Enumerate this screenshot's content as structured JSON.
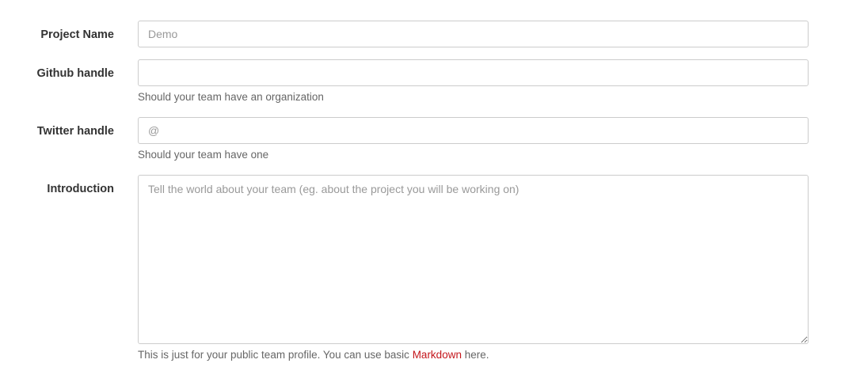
{
  "project_name": {
    "label": "Project Name",
    "value": "",
    "placeholder": "Demo"
  },
  "github": {
    "label": "Github handle",
    "value": "",
    "placeholder": "",
    "help": "Should your team have an organization"
  },
  "twitter": {
    "label": "Twitter handle",
    "value": "",
    "placeholder": "@",
    "help": "Should your team have one"
  },
  "introduction": {
    "label": "Introduction",
    "value": "",
    "placeholder": "Tell the world about your team (eg. about the project you will be working on)",
    "help_prefix": "This is just for your public team profile. You can use basic ",
    "help_link": "Markdown",
    "help_suffix": " here."
  },
  "colors": {
    "link": "#c4161c",
    "border": "#cccccc",
    "label": "#333333",
    "help": "#666666"
  }
}
